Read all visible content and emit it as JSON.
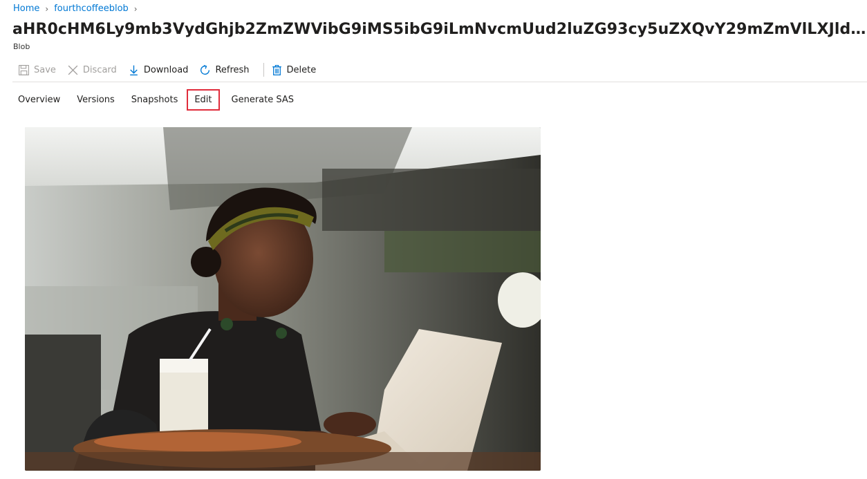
{
  "breadcrumb": {
    "home": "Home",
    "container": "fourthcoffeeblob"
  },
  "blob": {
    "title": "aHR0cHM6Ly9mb3VydGhjb2ZmZWVibG9iMS5ibG9iLmNvcmUud2luZG93cy5uZXQvY29mZmVlLXJldmlld3MvcmV2aW…",
    "type": "Blob"
  },
  "toolbar": {
    "save_label": "Save",
    "discard_label": "Discard",
    "download_label": "Download",
    "refresh_label": "Refresh",
    "delete_label": "Delete",
    "icons": [
      "save-icon",
      "discard-icon",
      "download-icon",
      "refresh-icon",
      "delete-icon"
    ],
    "accent": "#0078d4"
  },
  "tabs": [
    {
      "label": "Overview"
    },
    {
      "label": "Versions"
    },
    {
      "label": "Snapshots"
    },
    {
      "label": "Edit",
      "selected": true
    },
    {
      "label": "Generate SAS"
    }
  ],
  "highlight_color": "#e02c3b"
}
